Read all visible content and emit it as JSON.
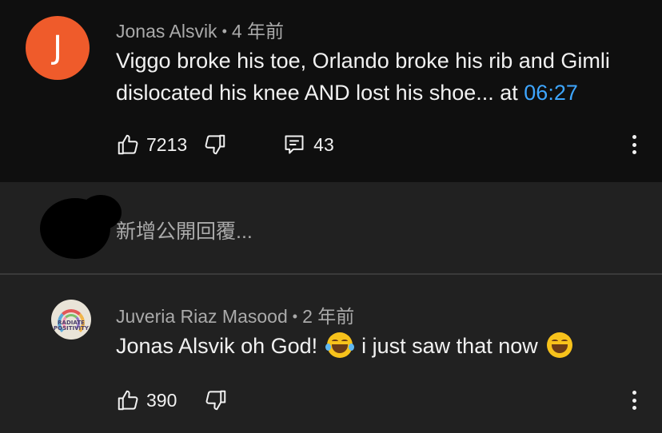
{
  "comments": [
    {
      "avatar_letter": "J",
      "author": "Jonas Alsvik",
      "separator": "•",
      "time": "4 年前",
      "text": "Viggo broke his toe, Orlando broke his rib and Gimli dislocated his knee AND lost his shoe... at ",
      "timestamp_link": "06:27",
      "likes": "7213",
      "replies": "43",
      "accent_color": "#ef5b2b"
    }
  ],
  "reply_box": {
    "placeholder": "新增公開回覆..."
  },
  "replies": [
    {
      "avatar_text_line1": "RADIATE",
      "avatar_text_line2": "POSITIVITY",
      "author": "Juveria Riaz Masood",
      "separator": "•",
      "time": "2 年前",
      "text_part1": "Jonas Alsvik oh God! ",
      "emoji1": "face-with-tears-of-joy",
      "text_part2": " i just saw that now ",
      "emoji2": "grinning-squinting-face",
      "likes": "390"
    }
  ],
  "colors": {
    "background": "#0f0f0f",
    "reply_panel": "#212121",
    "link": "#3ea6ff",
    "secondary_text": "#aaaaaa"
  }
}
